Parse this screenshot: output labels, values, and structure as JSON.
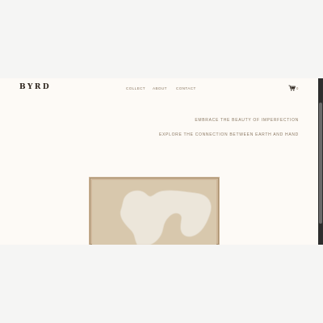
{
  "brand": {
    "logo_text": "BYRD"
  },
  "nav": {
    "items": [
      {
        "label": "COLLECT"
      },
      {
        "label": "ABOUT"
      },
      {
        "label": "CONTACT"
      }
    ]
  },
  "cart": {
    "count": "0",
    "icon": "cart-icon"
  },
  "hero": {
    "tagline_1": "EMBRACE THE BEAUTY OF IMPERFECTION",
    "tagline_2": "EXPLORE THE CONNECTION BETWEEN EARTH AND HAND"
  },
  "artwork": {
    "frame_color": "#cfb79a",
    "canvas_color": "#d8c8ad",
    "shape_color": "#ece6da"
  },
  "colors": {
    "page_bg": "#fdfaf6",
    "text_muted": "#8c7a64",
    "logo": "#2d241c",
    "scrollbar": "#2e2e2e"
  }
}
